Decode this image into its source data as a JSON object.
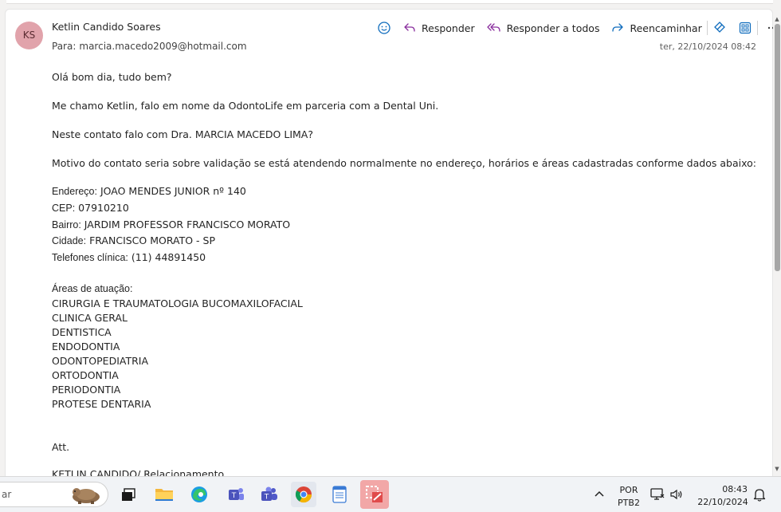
{
  "email": {
    "sender_initials": "KS",
    "sender_name": "Ketlin Candido Soares",
    "to_label": "Para:",
    "to_address": "marcia.macedo2009@hotmail.com",
    "date": "ter, 22/10/2024 08:42",
    "avatar_color": "#e1a3ab"
  },
  "actions": {
    "reply": "Responder",
    "reply_all": "Responder a todos",
    "forward": "Reencaminhar"
  },
  "body": {
    "greeting": "Olá bom dia, tudo bem?",
    "intro": "Me chamo Ketlin, falo em nome da OdontoLife em parceria com a Dental Uni.",
    "question": "Neste contato falo com Dra. MARCIA MACEDO LIMA?",
    "motive": "Motivo do contato seria sobre validação se está atendendo normalmente no endereço, horários e áreas cadastradas conforme dados abaixo:",
    "address_label": "Endereço:",
    "address_value": " JOAO MENDES JUNIOR nº 140",
    "cep_label": "CEP:",
    "cep_value": " 07910210",
    "bairro_label": "Bairro:",
    "bairro_value": " JARDIM PROFESSOR FRANCISCO MORATO",
    "cidade_label": "Cidade:",
    "cidade_value": " FRANCISCO MORATO - SP",
    "phone_label": "Telefones clínica:",
    "phone_value": " (11) 44891450",
    "areas_title": "Áreas de atuação:",
    "areas": [
      "CIRURGIA E TRAUMATOLOGIA BUCOMAXILOFACIAL",
      "CLINICA GERAL",
      "DENTISTICA",
      "ENDODONTIA",
      "ODONTOPEDIATRIA",
      "ORTODONTIA",
      "PERIODONTIA",
      "PROTESE DENTARIA"
    ],
    "signoff": "Att.",
    "signature": "KETLIN CANDIDO/ Relacionamento"
  },
  "taskbar": {
    "search_text": "ar",
    "lang_top": "POR",
    "lang_bottom": "PTB2",
    "time": "08:43",
    "date": "22/10/2024"
  }
}
